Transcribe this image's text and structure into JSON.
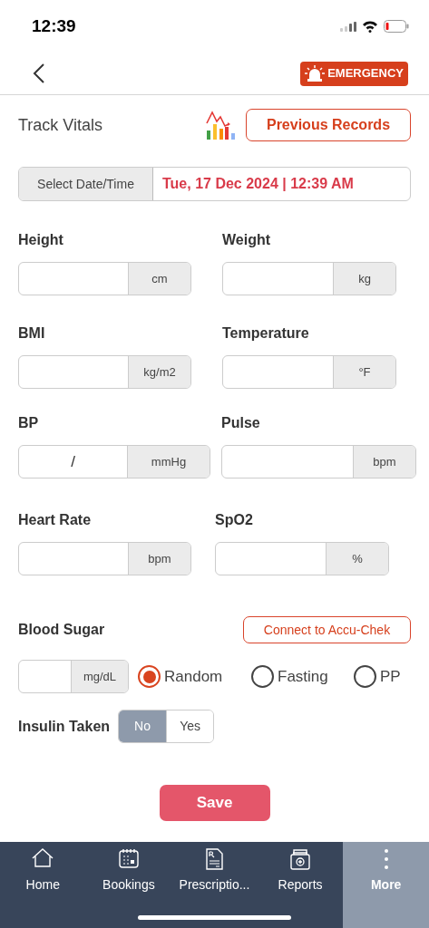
{
  "status_bar": {
    "time": "12:39"
  },
  "header": {
    "emergency_label": "EMERGENCY"
  },
  "title": "Track Vitals",
  "previous_records": "Previous Records",
  "date": {
    "label": "Select Date/Time",
    "value": "Tue, 17 Dec 2024 | 12:39 AM"
  },
  "vitals": [
    [
      {
        "label": "Height",
        "unit": "cm"
      },
      {
        "label": "Weight",
        "unit": "kg"
      }
    ],
    [
      {
        "label": "BMI",
        "unit": "kg/m2"
      },
      {
        "label": "Temperature",
        "unit": "°F"
      }
    ],
    [
      {
        "label": "BP",
        "unit": "mmHg",
        "separator": "/"
      },
      {
        "label": "Pulse",
        "unit": "bpm"
      }
    ],
    [
      {
        "label": "Heart Rate",
        "unit": "bpm"
      },
      {
        "label": "SpO2",
        "unit": "%"
      }
    ]
  ],
  "blood_sugar": {
    "label": "Blood Sugar",
    "connect_button": "Connect to Accu-Chek",
    "unit": "mg/dL",
    "options": [
      {
        "label": "Random",
        "selected": true
      },
      {
        "label": "Fasting",
        "selected": false
      },
      {
        "label": "PP",
        "selected": false
      }
    ]
  },
  "insulin": {
    "label": "Insulin Taken",
    "options": [
      {
        "label": "No",
        "selected": true
      },
      {
        "label": "Yes",
        "selected": false
      }
    ]
  },
  "save": "Save",
  "nav": [
    {
      "label": "Home",
      "kind": "home",
      "selected": false
    },
    {
      "label": "Bookings",
      "kind": "bookings",
      "selected": false
    },
    {
      "label": "Prescriptio...",
      "kind": "prescriptions",
      "selected": false
    },
    {
      "label": "Reports",
      "kind": "reports",
      "selected": false
    },
    {
      "label": "More",
      "kind": "more",
      "selected": true
    }
  ]
}
